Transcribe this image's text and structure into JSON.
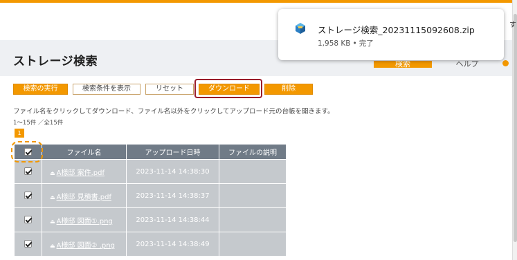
{
  "page": {
    "title": "ストレージ検索"
  },
  "tabs": {
    "search": "検索",
    "help": "ヘルプ"
  },
  "side_char": "す",
  "toolbar": {
    "search": "検索の実行",
    "show_conditions": "検索条件を表示",
    "reset": "リセット",
    "download": "ダウンロード",
    "delete": "削除"
  },
  "instructions": "ファイル名をクリックしてダウンロード、ファイル名以外をクリックしてアップロード元の台帳を開きます。",
  "result_count": "1〜15件 ／全15件",
  "pagination": {
    "current": "1"
  },
  "table": {
    "headers": {
      "name": "ファイル名",
      "uploaded": "アップロード日時",
      "description": "ファイルの説明"
    },
    "rows": [
      {
        "name": "A様邸 案件.pdf",
        "uploaded": "2023-11-14 14:38:30",
        "description": ""
      },
      {
        "name": "A様邸 見積書.pdf",
        "uploaded": "2023-11-14 14:38:37",
        "description": ""
      },
      {
        "name": "A様邸 図面①.png",
        "uploaded": "2023-11-14 14:38:44",
        "description": ""
      },
      {
        "name": "A様邸 図面② .png",
        "uploaded": "2023-11-14 14:38:49",
        "description": ""
      }
    ]
  },
  "download_popup": {
    "filename": "ストレージ検索_20231115092608.zip",
    "size": "1,958 KB",
    "status": "完了"
  },
  "colors": {
    "accent": "#f39800",
    "table_header": "#707b87",
    "table_cell": "#c5c9cd",
    "highlight": "#9a1c2a"
  },
  "icons": [
    "checkbox-icon",
    "download-icon",
    "zip-file-icon"
  ]
}
